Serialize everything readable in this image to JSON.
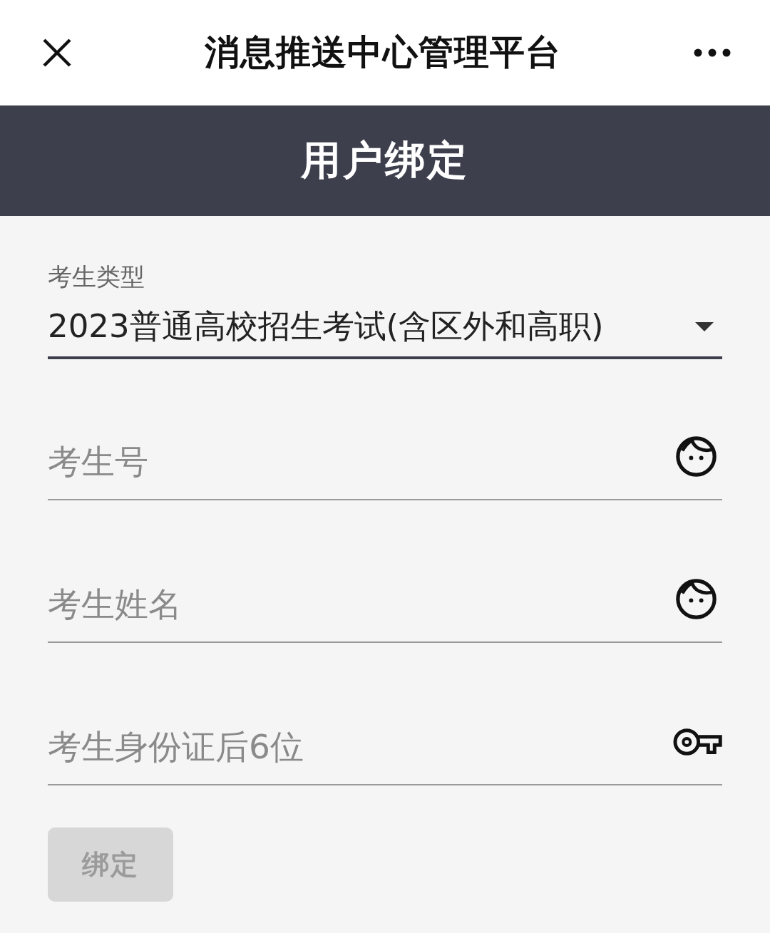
{
  "top_bar": {
    "title": "消息推送中心管理平台"
  },
  "header": {
    "title": "用户绑定"
  },
  "form": {
    "select": {
      "label": "考生类型",
      "value": "2023普通高校招生考试(含区外和高职)"
    },
    "fields": [
      {
        "placeholder": "考生号",
        "kind": "person"
      },
      {
        "placeholder": "考生姓名",
        "kind": "person"
      },
      {
        "placeholder": "考生身份证后6位",
        "kind": "key"
      }
    ],
    "button": {
      "label": "绑定",
      "disabled": true
    }
  }
}
